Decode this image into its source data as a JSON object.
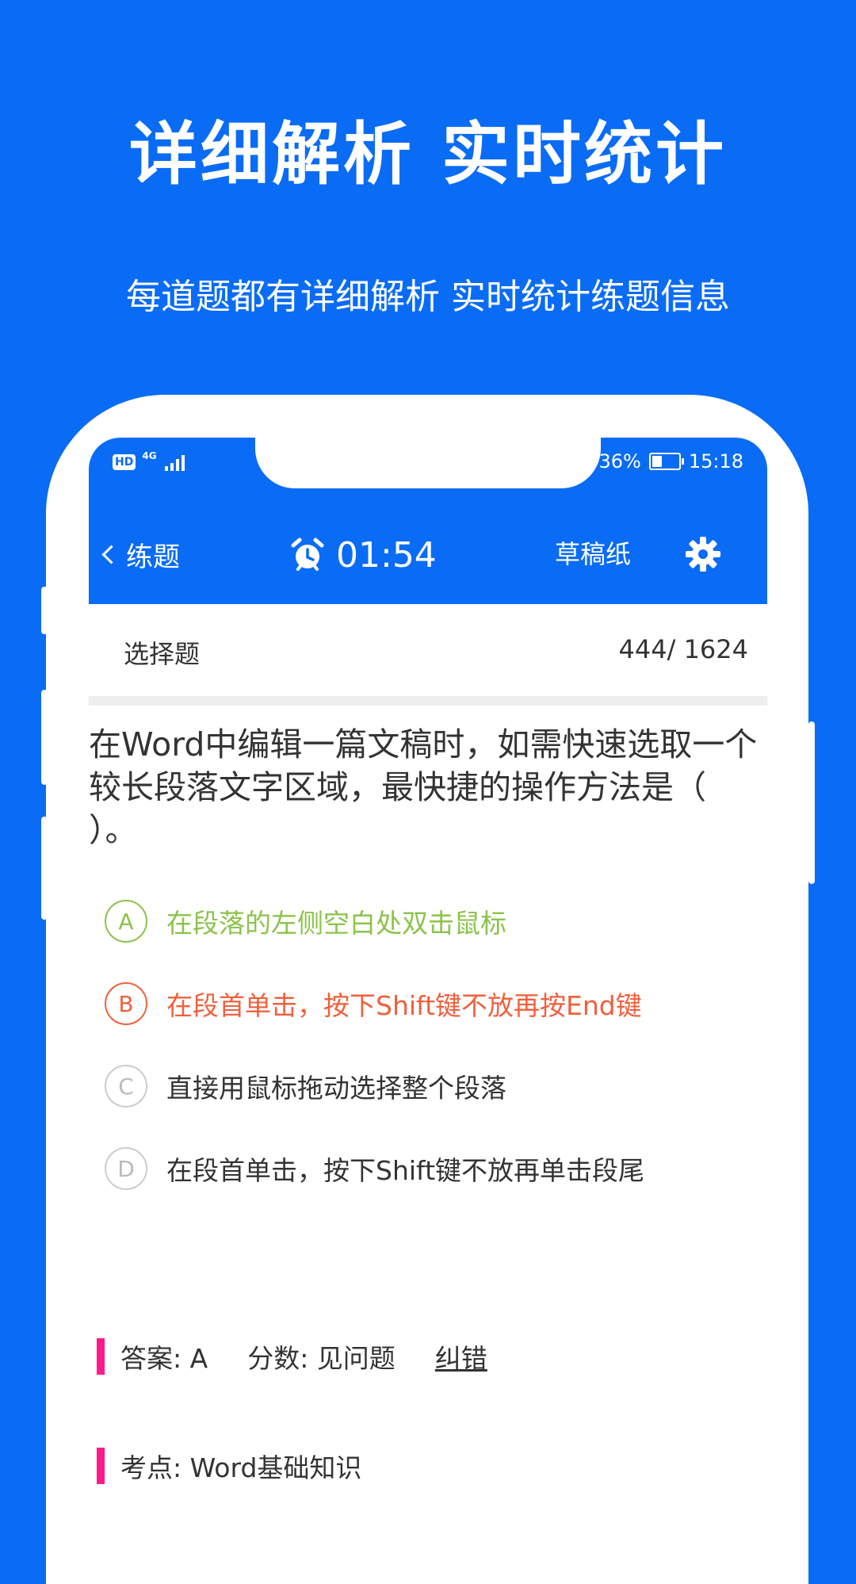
{
  "promo": {
    "title": "详细解析 实时统计",
    "subtitle": "每道题都有详细解析 实时统计练题信息"
  },
  "status_bar": {
    "hd": "HD",
    "network": "4G",
    "battery": "36%",
    "time": "15:18"
  },
  "nav": {
    "back_label": "练题",
    "timer": "01:54",
    "draft_label": "草稿纸"
  },
  "question": {
    "type": "选择题",
    "progress": "444/ 1624",
    "text": "在Word中编辑一篇文稿时，如需快速选取一个较长段落文字区域，最快捷的操作方法是（ ）。",
    "options": [
      {
        "letter": "A",
        "text": "在段落的左侧空白处双击鼠标",
        "state": "correct"
      },
      {
        "letter": "B",
        "text": "在段首单击，按下Shift键不放再按End键",
        "state": "wrong"
      },
      {
        "letter": "C",
        "text": "直接用鼠标拖动选择整个段落",
        "state": "normal"
      },
      {
        "letter": "D",
        "text": "在段首单击，按下Shift键不放再单击段尾",
        "state": "normal"
      }
    ]
  },
  "answer": {
    "answer_text": "答案: A",
    "score_text": "分数: 见问题",
    "report_label": "纠错",
    "point_text": "考点: Word基础知识"
  },
  "colors": {
    "brand": "#0a6cf5",
    "correct": "#8bc34a",
    "wrong": "#f0603c",
    "accent_bar": "#ff1a8c"
  }
}
